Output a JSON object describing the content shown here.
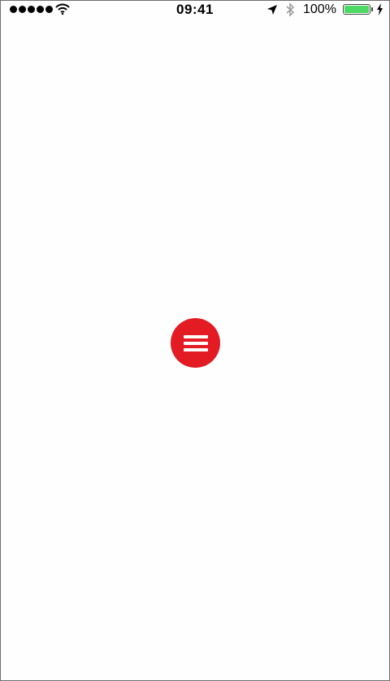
{
  "status_bar": {
    "time": "09:41",
    "battery_percent": "100%",
    "battery_level": 1.0,
    "signal_bars": 5,
    "icons": [
      "signal-dots-icon",
      "wifi-icon",
      "location-arrow-icon",
      "bluetooth-icon",
      "battery-icon",
      "charging-bolt-icon"
    ]
  },
  "menu_button": {
    "icon": "hamburger-icon",
    "color": "#e31b23"
  },
  "colors": {
    "background": "#fefefe",
    "accent": "#e31b23",
    "battery": "#4cd964"
  }
}
